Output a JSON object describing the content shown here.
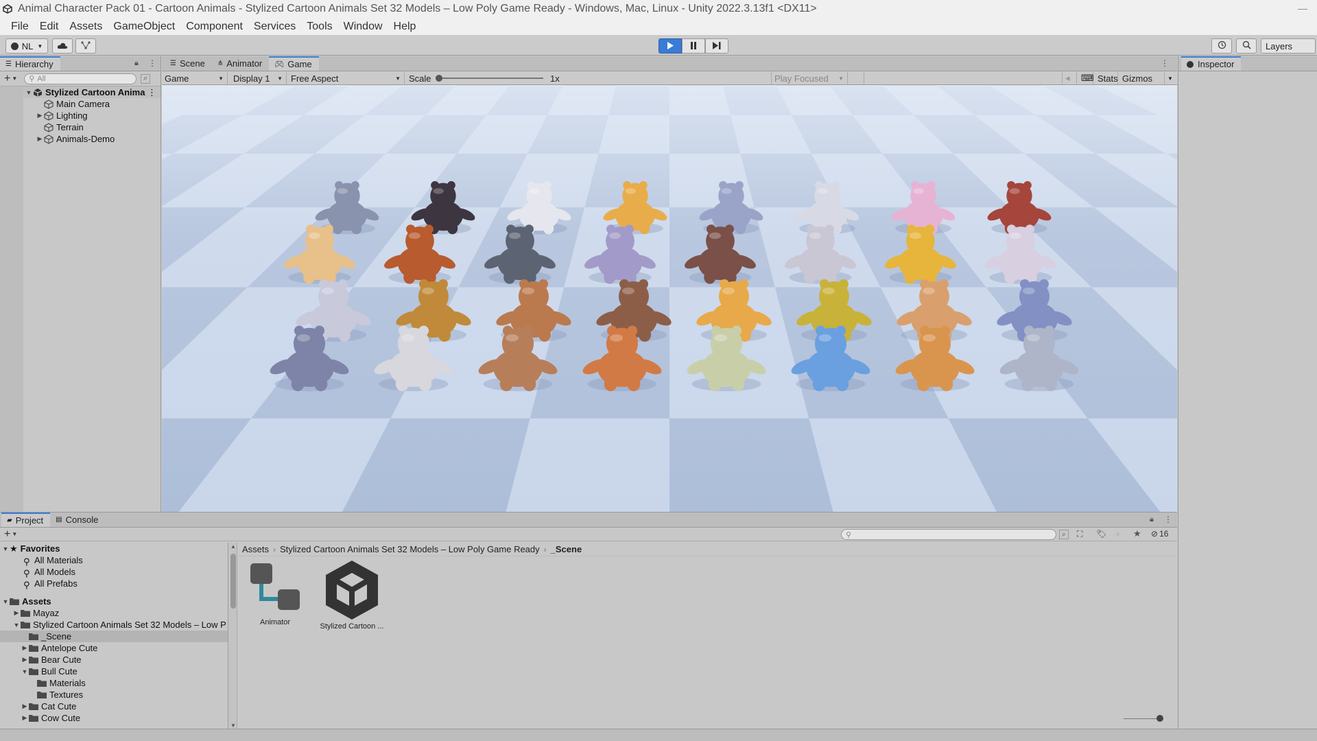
{
  "window": {
    "title": "Animal Character Pack 01 - Cartoon Animals - Stylized Cartoon Animals Set 32 Models – Low Poly Game Ready - Windows, Mac, Linux - Unity 2022.3.13f1 <DX11>"
  },
  "menu": [
    "File",
    "Edit",
    "Assets",
    "GameObject",
    "Component",
    "Services",
    "Tools",
    "Window",
    "Help"
  ],
  "toolbar": {
    "account_label": "NL",
    "layers_label": "Layers"
  },
  "hierarchy": {
    "tab_label": "Hierarchy",
    "search_placeholder": "All",
    "root": "Stylized Cartoon Anima",
    "items": [
      "Main Camera",
      "Lighting",
      "Terrain",
      "Animals-Demo"
    ]
  },
  "center_tabs": [
    "Scene",
    "Animator",
    "Game"
  ],
  "game_toolbar": {
    "mode": "Game",
    "display": "Display 1",
    "aspect": "Free Aspect",
    "scale_label": "Scale",
    "scale_value": "1x",
    "play_mode": "Play Focused",
    "stats": "Stats",
    "gizmos": "Gizmos"
  },
  "inspector": {
    "tab_label": "Inspector"
  },
  "project": {
    "tabs": [
      "Project",
      "Console"
    ],
    "favorites_label": "Favorites",
    "favorites": [
      "All Materials",
      "All Models",
      "All Prefabs"
    ],
    "assets_label": "Assets",
    "tree": [
      {
        "label": "Mayaz",
        "depth": 1,
        "expanded": false
      },
      {
        "label": "Stylized Cartoon Animals Set 32 Models – Low P",
        "depth": 1,
        "expanded": true
      },
      {
        "label": "_Scene",
        "depth": 2,
        "expanded": null,
        "highlight": true
      },
      {
        "label": "Antelope Cute",
        "depth": 2,
        "expanded": false
      },
      {
        "label": "Bear Cute",
        "depth": 2,
        "expanded": false
      },
      {
        "label": "Bull Cute",
        "depth": 2,
        "expanded": true
      },
      {
        "label": "Materials",
        "depth": 3,
        "expanded": null
      },
      {
        "label": "Textures",
        "depth": 3,
        "expanded": null
      },
      {
        "label": "Cat Cute",
        "depth": 2,
        "expanded": false
      },
      {
        "label": "Cow Cute",
        "depth": 2,
        "expanded": false
      }
    ],
    "breadcrumb": [
      "Assets",
      "Stylized Cartoon Animals Set 32 Models – Low Poly Game Ready",
      "_Scene"
    ],
    "hidden_count": "16",
    "assets": [
      {
        "label": "Animator",
        "icon": "animator-controller-icon"
      },
      {
        "label": "Stylized Cartoon ...",
        "icon": "unity-scene-icon"
      }
    ]
  },
  "colors": {
    "accent": "#3a7bd5",
    "panel": "#c8c8c8",
    "tile_light": "#c9d6ea",
    "tile_dark": "#adbed9"
  },
  "animals": [
    {
      "color": "#8a93ad"
    },
    {
      "color": "#3d3540"
    },
    {
      "color": "#e6e7ee"
    },
    {
      "color": "#e8ad4a"
    },
    {
      "color": "#9aa3c8"
    },
    {
      "color": "#d7dae4"
    },
    {
      "color": "#e6b3d5"
    },
    {
      "color": "#a5453c"
    },
    {
      "color": "#e8c08a"
    },
    {
      "color": "#b85b2e"
    },
    {
      "color": "#5c6373"
    },
    {
      "color": "#a29ac8"
    },
    {
      "color": "#7a5048"
    },
    {
      "color": "#c9c7d3"
    },
    {
      "color": "#e7b53c"
    },
    {
      "color": "#d8cfe0"
    },
    {
      "color": "#c9c9dc"
    },
    {
      "color": "#c08a3a"
    },
    {
      "color": "#bb7a4e"
    },
    {
      "color": "#8c5e48"
    },
    {
      "color": "#e8a94a"
    },
    {
      "color": "#c9b23a"
    },
    {
      "color": "#d9a06e"
    },
    {
      "color": "#8290c4"
    },
    {
      "color": "#7e84a8"
    },
    {
      "color": "#d7d7dd"
    },
    {
      "color": "#b77e5a"
    },
    {
      "color": "#d27a45"
    },
    {
      "color": "#c8cfa8"
    },
    {
      "color": "#6aa0e0"
    },
    {
      "color": "#d9954e"
    },
    {
      "color": "#aeb5c8"
    }
  ]
}
